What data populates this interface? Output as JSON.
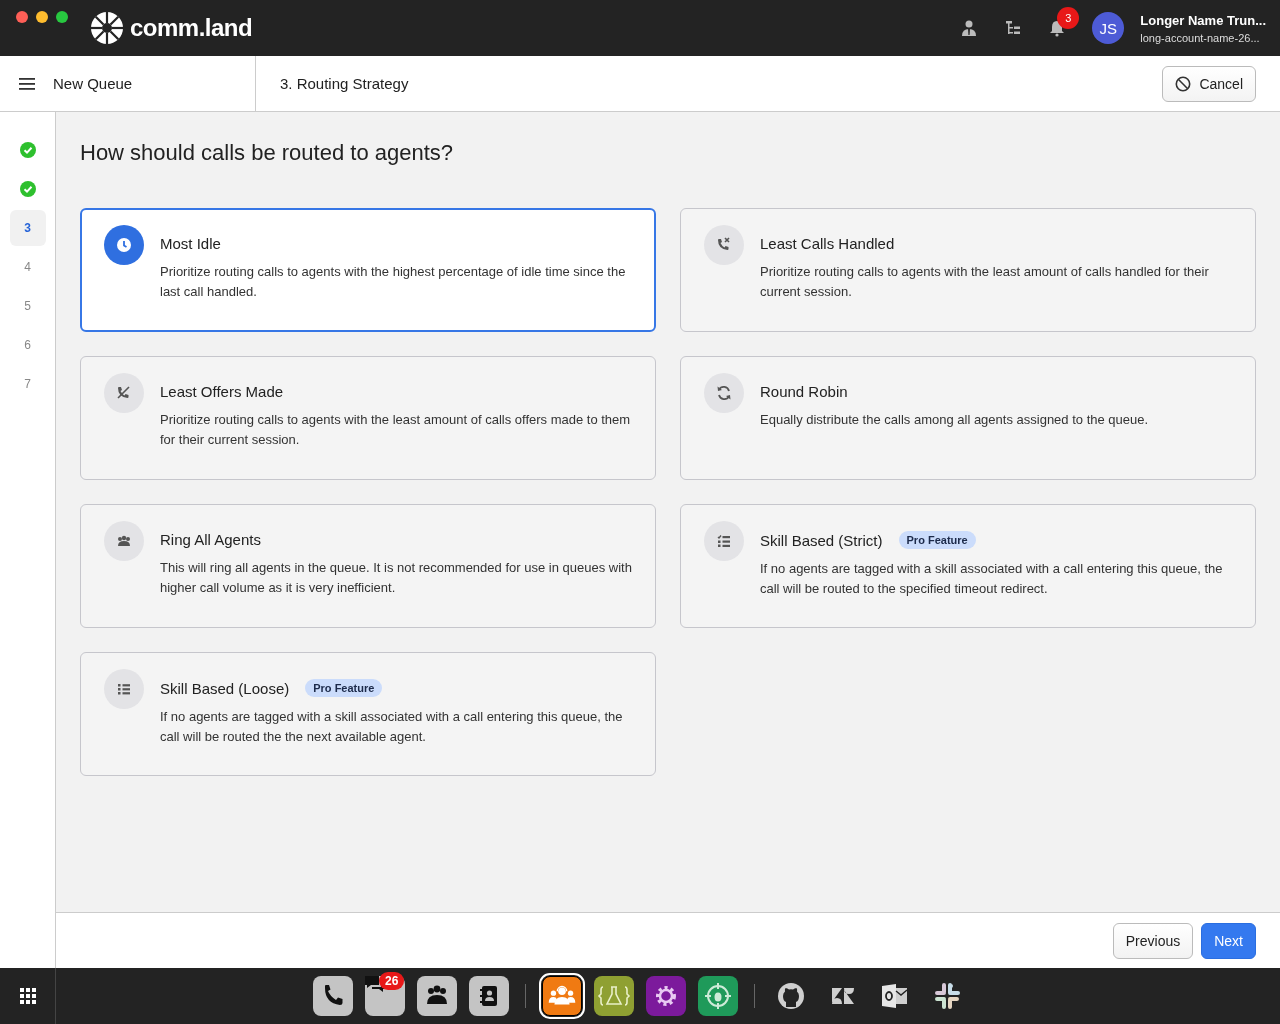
{
  "topbar": {
    "brand": "comm.land",
    "notifications": "3",
    "avatar": "JS",
    "user_name": "Longer Name Trun...",
    "account": "long-account-name-26..."
  },
  "header": {
    "queue_title": "New Queue",
    "step_title": "3. Routing Strategy",
    "cancel": "Cancel"
  },
  "steps": [
    {
      "completed": true,
      "selected": false
    },
    {
      "completed": true,
      "selected": false
    },
    {
      "completed": false,
      "selected": true,
      "label": "3"
    },
    {
      "completed": false,
      "selected": false,
      "label": "4"
    },
    {
      "completed": false,
      "selected": false,
      "label": "5"
    },
    {
      "completed": false,
      "selected": false,
      "label": "6"
    },
    {
      "completed": false,
      "selected": false,
      "label": "7"
    }
  ],
  "question": "How should calls be routed to agents?",
  "cards": [
    {
      "kind": "idle",
      "selected": true,
      "title": "Most Idle",
      "description": "Prioritize routing calls to agents with the highest percentage of idle time since the last call handled."
    },
    {
      "kind": "handled",
      "selected": false,
      "title": "Least Calls Handled",
      "description": "Prioritize routing calls to agents with the least amount of calls handled for their current session."
    },
    {
      "kind": "offers",
      "selected": false,
      "title": "Least Offers Made",
      "description": "Prioritize routing calls to agents with the least amount of calls offers made to them for their current session."
    },
    {
      "kind": "robin",
      "selected": false,
      "title": "Round Robin",
      "description": "Equally distribute the calls among all agents assigned to the queue."
    },
    {
      "kind": "ringall",
      "selected": false,
      "title": "Ring All Agents",
      "description": "This will ring all agents in the queue. It is not recommended for use in queues with higher call volume as it is very inefficient."
    },
    {
      "kind": "strict",
      "selected": false,
      "title": "Skill Based (Strict)",
      "badge": "Pro Feature",
      "description": "If no agents are tagged with a skill associated with a call entering this queue, the call will be routed to the specified timeout redirect."
    },
    {
      "kind": "loose",
      "selected": false,
      "title": "Skill Based (Loose)",
      "badge": "Pro Feature",
      "description": "If no agents are tagged with a skill associated with a call entering this queue, the call will be routed the the next available agent."
    }
  ],
  "footer": {
    "previous": "Previous",
    "next": "Next"
  },
  "dock": [
    {
      "kind": "phone",
      "color": "#c4c4c4",
      "selected": false
    },
    {
      "kind": "chat",
      "color": "#c4c4c4",
      "selected": false,
      "badge": "26"
    },
    {
      "kind": "group",
      "color": "#c4c4c4",
      "selected": false
    },
    {
      "kind": "contacts",
      "color": "#c4c4c4",
      "selected": false
    },
    {
      "kind": "separator"
    },
    {
      "kind": "agents",
      "color": "#f07a12",
      "selected": true
    },
    {
      "kind": "lab",
      "color": "#8fa032",
      "selected": false
    },
    {
      "kind": "gear",
      "color": "#7c1a9c",
      "selected": false
    },
    {
      "kind": "bug",
      "color": "#1f9a5a",
      "selected": false
    },
    {
      "kind": "separator"
    },
    {
      "kind": "github",
      "selected": false
    },
    {
      "kind": "zendesk",
      "selected": false
    },
    {
      "kind": "outlook",
      "selected": false
    },
    {
      "kind": "slack",
      "selected": false
    }
  ]
}
